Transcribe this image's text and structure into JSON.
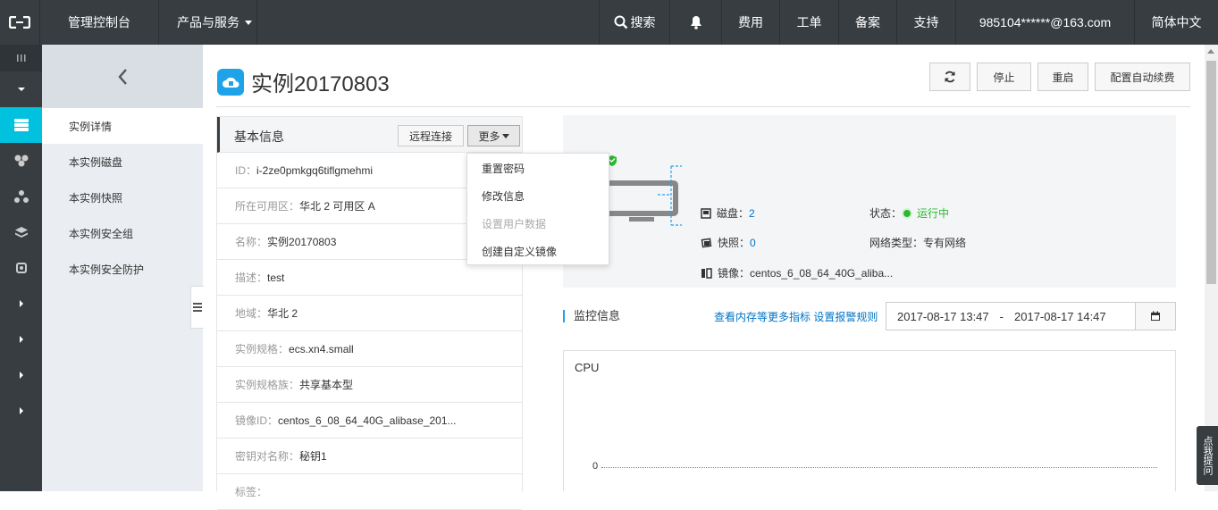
{
  "topbar": {
    "console": "管理控制台",
    "products": "产品与服务",
    "search": "搜索",
    "fees": "费用",
    "tickets": "工单",
    "filing": "备案",
    "support": "支持",
    "account": "985104******@163.com",
    "language": "简体中文"
  },
  "subnav": {
    "items": [
      {
        "label": "实例详情"
      },
      {
        "label": "本实例磁盘"
      },
      {
        "label": "本实例快照"
      },
      {
        "label": "本实例安全组"
      },
      {
        "label": "本实例安全防护"
      }
    ]
  },
  "page": {
    "title": "实例20170803",
    "actions": {
      "stop": "停止",
      "restart": "重启",
      "auto_renew": "配置自动续费"
    }
  },
  "basic": {
    "title": "基本信息",
    "remote_btn": "远程连接",
    "more_btn": "更多",
    "rows": [
      {
        "k": "ID：",
        "v": "i-2ze0pmkgq6tiflgmehmi"
      },
      {
        "k": "所在可用区：",
        "v": "华北 2 可用区 A"
      },
      {
        "k": "名称：",
        "v": "实例20170803"
      },
      {
        "k": "描述：",
        "v": "test"
      },
      {
        "k": "地域：",
        "v": "华北 2"
      },
      {
        "k": "实例规格：",
        "v": "ecs.xn4.small"
      },
      {
        "k": "实例规格族：",
        "v": "共享基本型"
      },
      {
        "k": "镜像ID：",
        "v": "centos_6_08_64_40G_alibase_201..."
      },
      {
        "k": "密钥对名称：",
        "v": "秘钥1"
      },
      {
        "k": "标签：",
        "v": ""
      }
    ]
  },
  "dropdown": {
    "items": [
      {
        "label": "重置密码"
      },
      {
        "label": "修改信息"
      },
      {
        "label": "设置用户数据"
      },
      {
        "label": "创建自定义镜像"
      }
    ]
  },
  "overview": {
    "disk_label": "磁盘：",
    "disk_value": "2",
    "snapshot_label": "快照：",
    "snapshot_value": "0",
    "image_label": "镜像：",
    "image_value": "centos_6_08_64_40G_aliba...",
    "status_label": "状态：",
    "status_value": "运行中",
    "network_label": "网络类型：",
    "network_value": "专有网络"
  },
  "monitor": {
    "title": "监控信息",
    "link_more": "查看内存等更多指标",
    "link_alarm": "设置报警规则",
    "start": "2017-08-17 13:47",
    "sep": "-",
    "end": "2017-08-17 14:47",
    "chart_title": "CPU",
    "zero_label": "0"
  },
  "feedback": "点我提问"
}
